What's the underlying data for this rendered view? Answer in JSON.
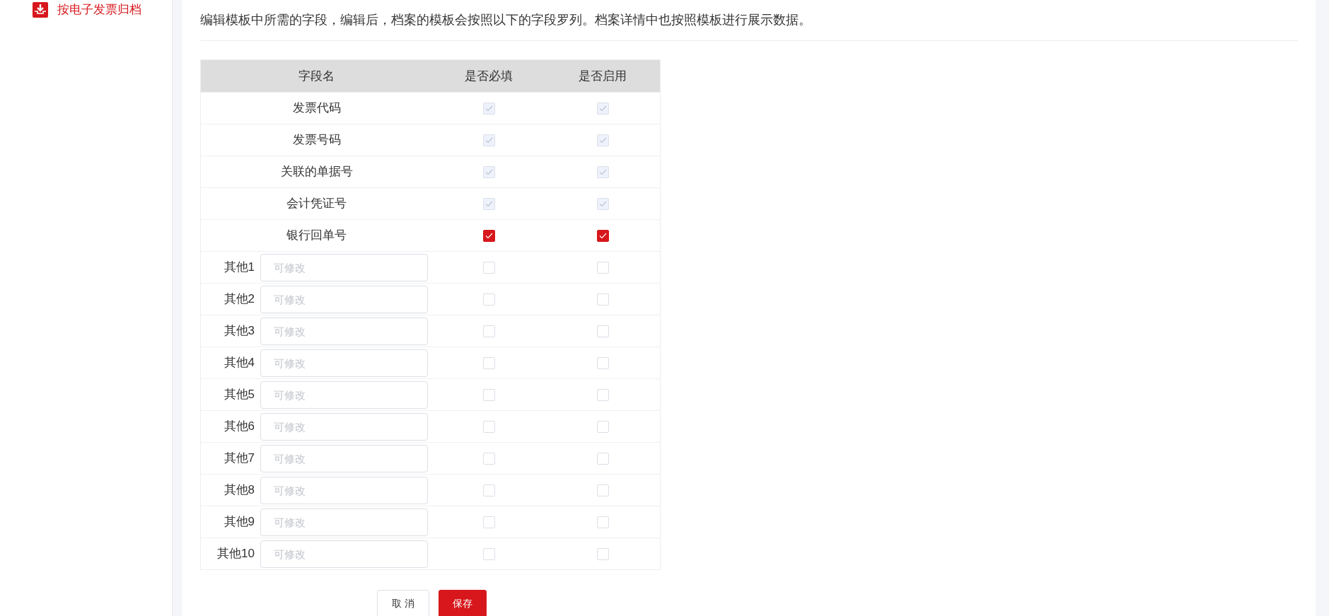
{
  "sidebar": {
    "items": [
      {
        "label": "按电子发票归档",
        "selected": true
      }
    ]
  },
  "description": "编辑模板中所需的字段，编辑后，档案的模板会按照以下的字段罗列。档案详情中也按照模板进行展示数据。",
  "table": {
    "columns": [
      "字段名",
      "是否必填",
      "是否启用"
    ],
    "rows": [
      {
        "kind": "fixed",
        "name": "发票代码",
        "required": {
          "checked": true,
          "disabled": true
        },
        "enabled": {
          "checked": true,
          "disabled": true
        }
      },
      {
        "kind": "fixed",
        "name": "发票号码",
        "required": {
          "checked": true,
          "disabled": true
        },
        "enabled": {
          "checked": true,
          "disabled": true
        }
      },
      {
        "kind": "fixed",
        "name": "关联的单据号",
        "required": {
          "checked": true,
          "disabled": true
        },
        "enabled": {
          "checked": true,
          "disabled": true
        }
      },
      {
        "kind": "fixed",
        "name": "会计凭证号",
        "required": {
          "checked": true,
          "disabled": true
        },
        "enabled": {
          "checked": true,
          "disabled": true
        }
      },
      {
        "kind": "fixed",
        "name": "银行回单号",
        "required": {
          "checked": true,
          "disabled": false
        },
        "enabled": {
          "checked": true,
          "disabled": false
        }
      },
      {
        "kind": "custom",
        "name": "其他1",
        "placeholder": "可修改",
        "required": {
          "checked": false,
          "disabled": false
        },
        "enabled": {
          "checked": false,
          "disabled": false
        }
      },
      {
        "kind": "custom",
        "name": "其他2",
        "placeholder": "可修改",
        "required": {
          "checked": false,
          "disabled": false
        },
        "enabled": {
          "checked": false,
          "disabled": false
        }
      },
      {
        "kind": "custom",
        "name": "其他3",
        "placeholder": "可修改",
        "required": {
          "checked": false,
          "disabled": false
        },
        "enabled": {
          "checked": false,
          "disabled": false
        }
      },
      {
        "kind": "custom",
        "name": "其他4",
        "placeholder": "可修改",
        "required": {
          "checked": false,
          "disabled": false
        },
        "enabled": {
          "checked": false,
          "disabled": false
        }
      },
      {
        "kind": "custom",
        "name": "其他5",
        "placeholder": "可修改",
        "required": {
          "checked": false,
          "disabled": false
        },
        "enabled": {
          "checked": false,
          "disabled": false
        }
      },
      {
        "kind": "custom",
        "name": "其他6",
        "placeholder": "可修改",
        "required": {
          "checked": false,
          "disabled": false
        },
        "enabled": {
          "checked": false,
          "disabled": false
        }
      },
      {
        "kind": "custom",
        "name": "其他7",
        "placeholder": "可修改",
        "required": {
          "checked": false,
          "disabled": false
        },
        "enabled": {
          "checked": false,
          "disabled": false
        }
      },
      {
        "kind": "custom",
        "name": "其他8",
        "placeholder": "可修改",
        "required": {
          "checked": false,
          "disabled": false
        },
        "enabled": {
          "checked": false,
          "disabled": false
        }
      },
      {
        "kind": "custom",
        "name": "其他9",
        "placeholder": "可修改",
        "required": {
          "checked": false,
          "disabled": false
        },
        "enabled": {
          "checked": false,
          "disabled": false
        }
      },
      {
        "kind": "custom",
        "name": "其他10",
        "placeholder": "可修改",
        "required": {
          "checked": false,
          "disabled": false
        },
        "enabled": {
          "checked": false,
          "disabled": false
        }
      }
    ]
  },
  "buttons": [
    {
      "kind": "secondary",
      "label": "取 消"
    },
    {
      "kind": "primary",
      "label": "保存"
    }
  ]
}
